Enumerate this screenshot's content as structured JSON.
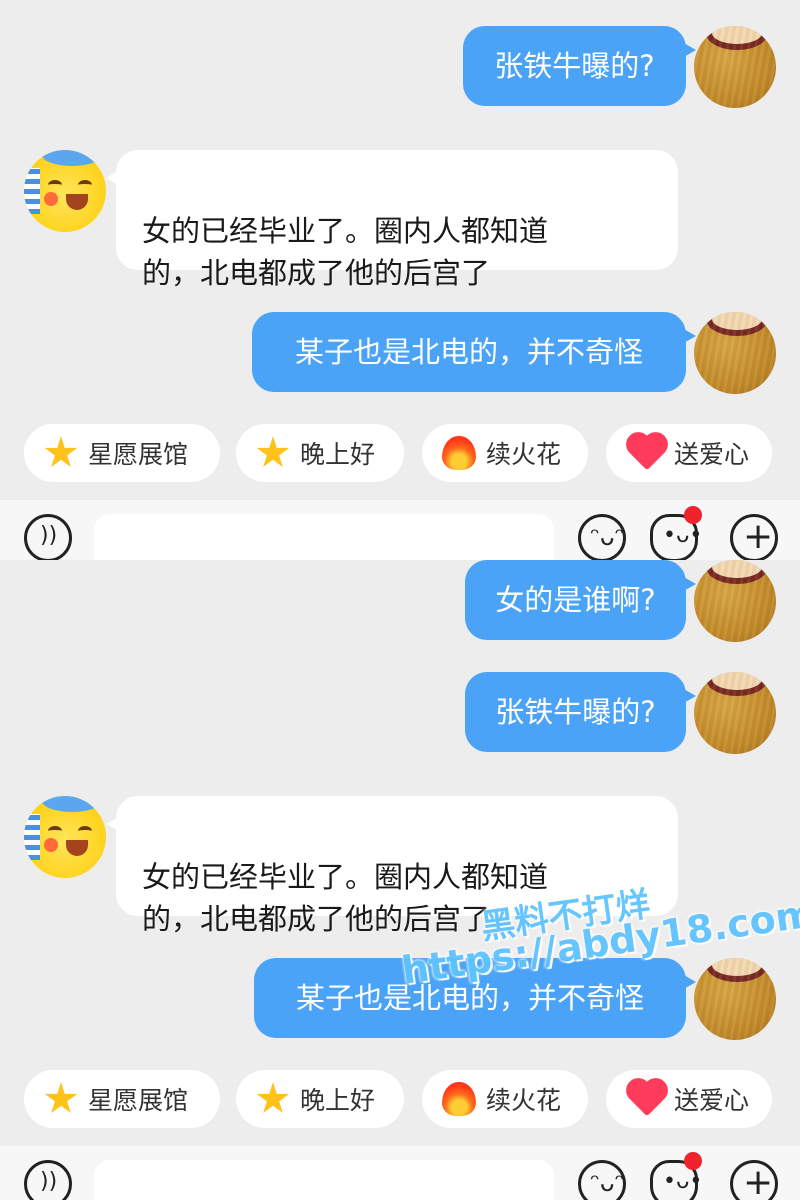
{
  "screen1": {
    "messages": [
      {
        "side": "out",
        "text": "张铁牛曝的?"
      },
      {
        "side": "in",
        "text": "女的已经毕业了。圈内人都知道\n的，北电都成了他的后宫了"
      },
      {
        "side": "out",
        "text": "某子也是北电的，并不奇怪"
      }
    ]
  },
  "screen2": {
    "messages": [
      {
        "side": "out",
        "text": "女的是谁啊?"
      },
      {
        "side": "out",
        "text": "张铁牛曝的?"
      },
      {
        "side": "in",
        "text": "女的已经毕业了。圈内人都知道\n的，北电都成了他的后宫了"
      },
      {
        "side": "out",
        "text": "某子也是北电的，并不奇怪"
      }
    ]
  },
  "quick_replies": [
    {
      "label": "星愿展馆",
      "icon": "star-icon"
    },
    {
      "label": "晚上好",
      "icon": "smiling-star-icon"
    },
    {
      "label": "续火花",
      "icon": "fire-icon"
    },
    {
      "label": "送爱心",
      "icon": "heart-icon"
    }
  ],
  "input_bar": {
    "voice_icon": "voice-icon",
    "emoji_icon": "emoji-icon",
    "sticker_icon": "sticker-icon",
    "plus_icon": "plus-icon",
    "notification_dot_color": "#f0232d"
  },
  "colors": {
    "outgoing_bubble": "#4aa3f7",
    "incoming_bubble": "#ffffff",
    "background": "#ededed"
  },
  "watermark": {
    "line1": "黑料不打烊",
    "line2": "https://abdy18.com"
  }
}
